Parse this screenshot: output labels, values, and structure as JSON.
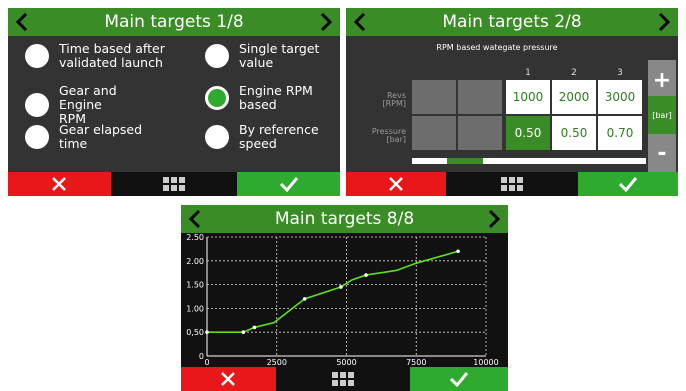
{
  "screen1": {
    "title": "Main targets 1/8",
    "options": [
      {
        "label": "Time based after validated launch",
        "selected": false
      },
      {
        "label": "Single target value",
        "selected": false
      },
      {
        "label": "Gear and Engine RPM",
        "selected": false
      },
      {
        "label": "Engine RPM based",
        "selected": true
      },
      {
        "label": "Gear elapsed time",
        "selected": false
      },
      {
        "label": "By reference speed",
        "selected": false
      }
    ]
  },
  "screen2": {
    "title": "Main targets 2/8",
    "subtitle": "RPM based wategate pressure",
    "columns": [
      "1",
      "2",
      "3"
    ],
    "rows": [
      {
        "label": "Revs",
        "unit": "[RPM]",
        "values": [
          "1000",
          "2000",
          "3000"
        ]
      },
      {
        "label": "Pressure",
        "unit": "[bar]",
        "values": [
          "0.50",
          "0.50",
          "0.70"
        ]
      }
    ],
    "selected_cell": "0.50",
    "plus_label": "+",
    "minus_label": "-",
    "unit_label": "[bar]",
    "scroll_position": 0.15
  },
  "screen3": {
    "title": "Main targets 8/8"
  },
  "icons": {
    "left": "chevron-left-icon",
    "right": "chevron-right-icon",
    "cancel": "close-icon",
    "menu": "grid-menu-icon",
    "ok": "check-icon"
  },
  "colors": {
    "header": "#3a8c26",
    "cancel": "#e8171a",
    "ok": "#2eaa2e",
    "line": "#5de11f",
    "panel": "#333333"
  },
  "chart_data": {
    "type": "line",
    "x": [
      0,
      1300,
      1700,
      2400,
      3500,
      4800,
      5200,
      5700,
      6800,
      7500,
      9000
    ],
    "y": [
      0.5,
      0.5,
      0.6,
      0.7,
      1.2,
      1.45,
      1.6,
      1.7,
      1.8,
      1.95,
      2.2
    ],
    "xlim": [
      0,
      10000
    ],
    "ylim": [
      0,
      2.5
    ],
    "xticks": [
      "0",
      "2500",
      "5000",
      "7500",
      "10000"
    ],
    "yticks": [
      "0",
      "0,50",
      "1.00",
      "1.50",
      "2.00",
      "2.50"
    ],
    "marked_x": [
      0,
      1300,
      1700,
      3500,
      4800,
      5700,
      9000
    ],
    "grid": true
  }
}
